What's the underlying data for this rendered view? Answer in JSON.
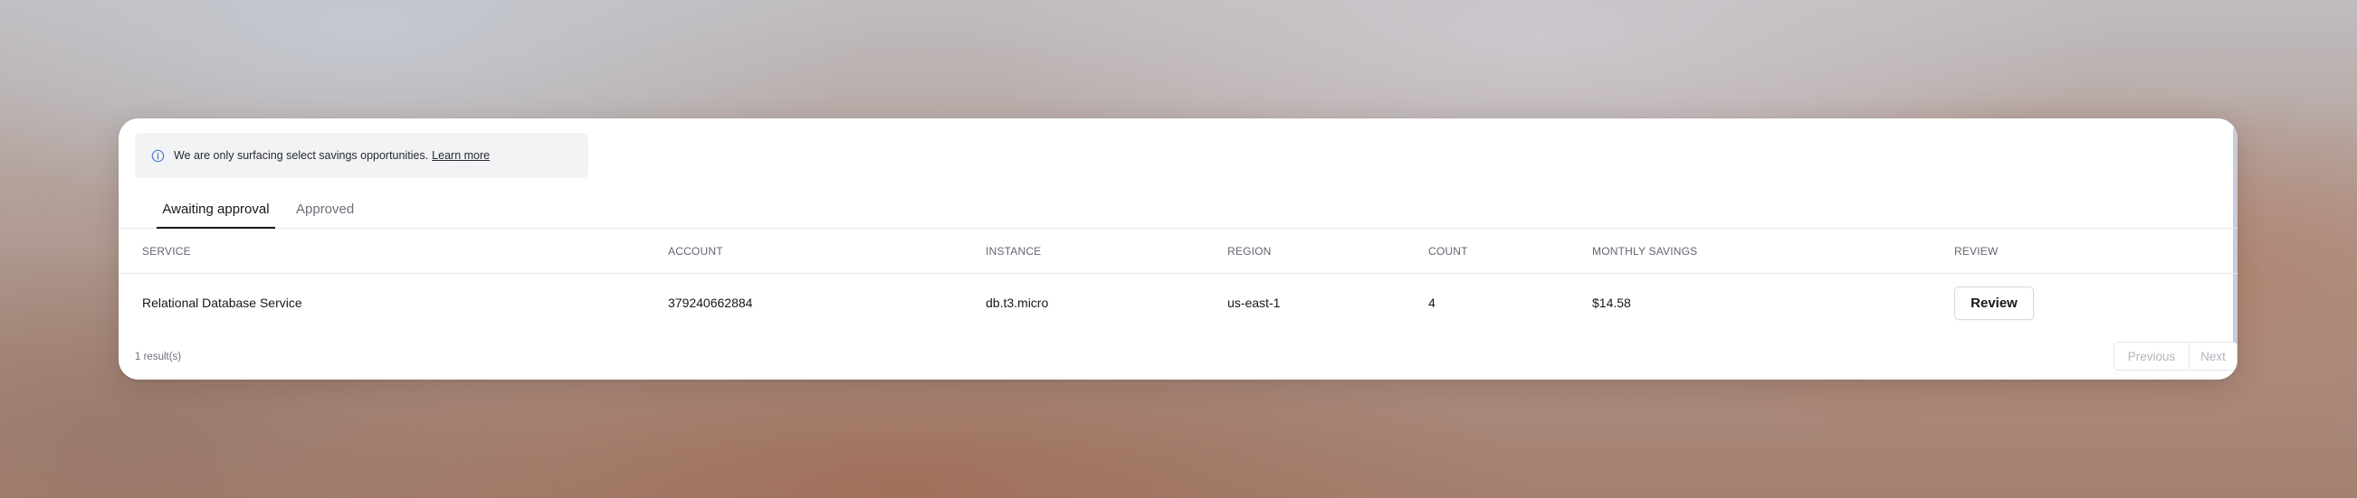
{
  "notice": {
    "text": "We are only surfacing select savings opportunities.",
    "link_label": "Learn more",
    "icon": "info-icon"
  },
  "tabs": [
    {
      "label": "Awaiting approval",
      "active": true
    },
    {
      "label": "Approved",
      "active": false
    }
  ],
  "table": {
    "columns": [
      "SERVICE",
      "ACCOUNT",
      "INSTANCE",
      "REGION",
      "COUNT",
      "MONTHLY SAVINGS",
      "REVIEW"
    ],
    "rows": [
      {
        "service": "Relational Database Service",
        "account": "379240662884",
        "instance": "db.t3.micro",
        "region": "us-east-1",
        "count": "4",
        "monthly_savings": "$14.58",
        "review_label": "Review"
      }
    ]
  },
  "footer": {
    "result_count": "1 result(s)",
    "previous_label": "Previous",
    "next_label": "Next"
  },
  "colors": {
    "info_icon": "#4a7fd6",
    "text_primary": "#15181d",
    "text_muted": "#6b7079",
    "pager_disabled": "#b2b5bc"
  }
}
